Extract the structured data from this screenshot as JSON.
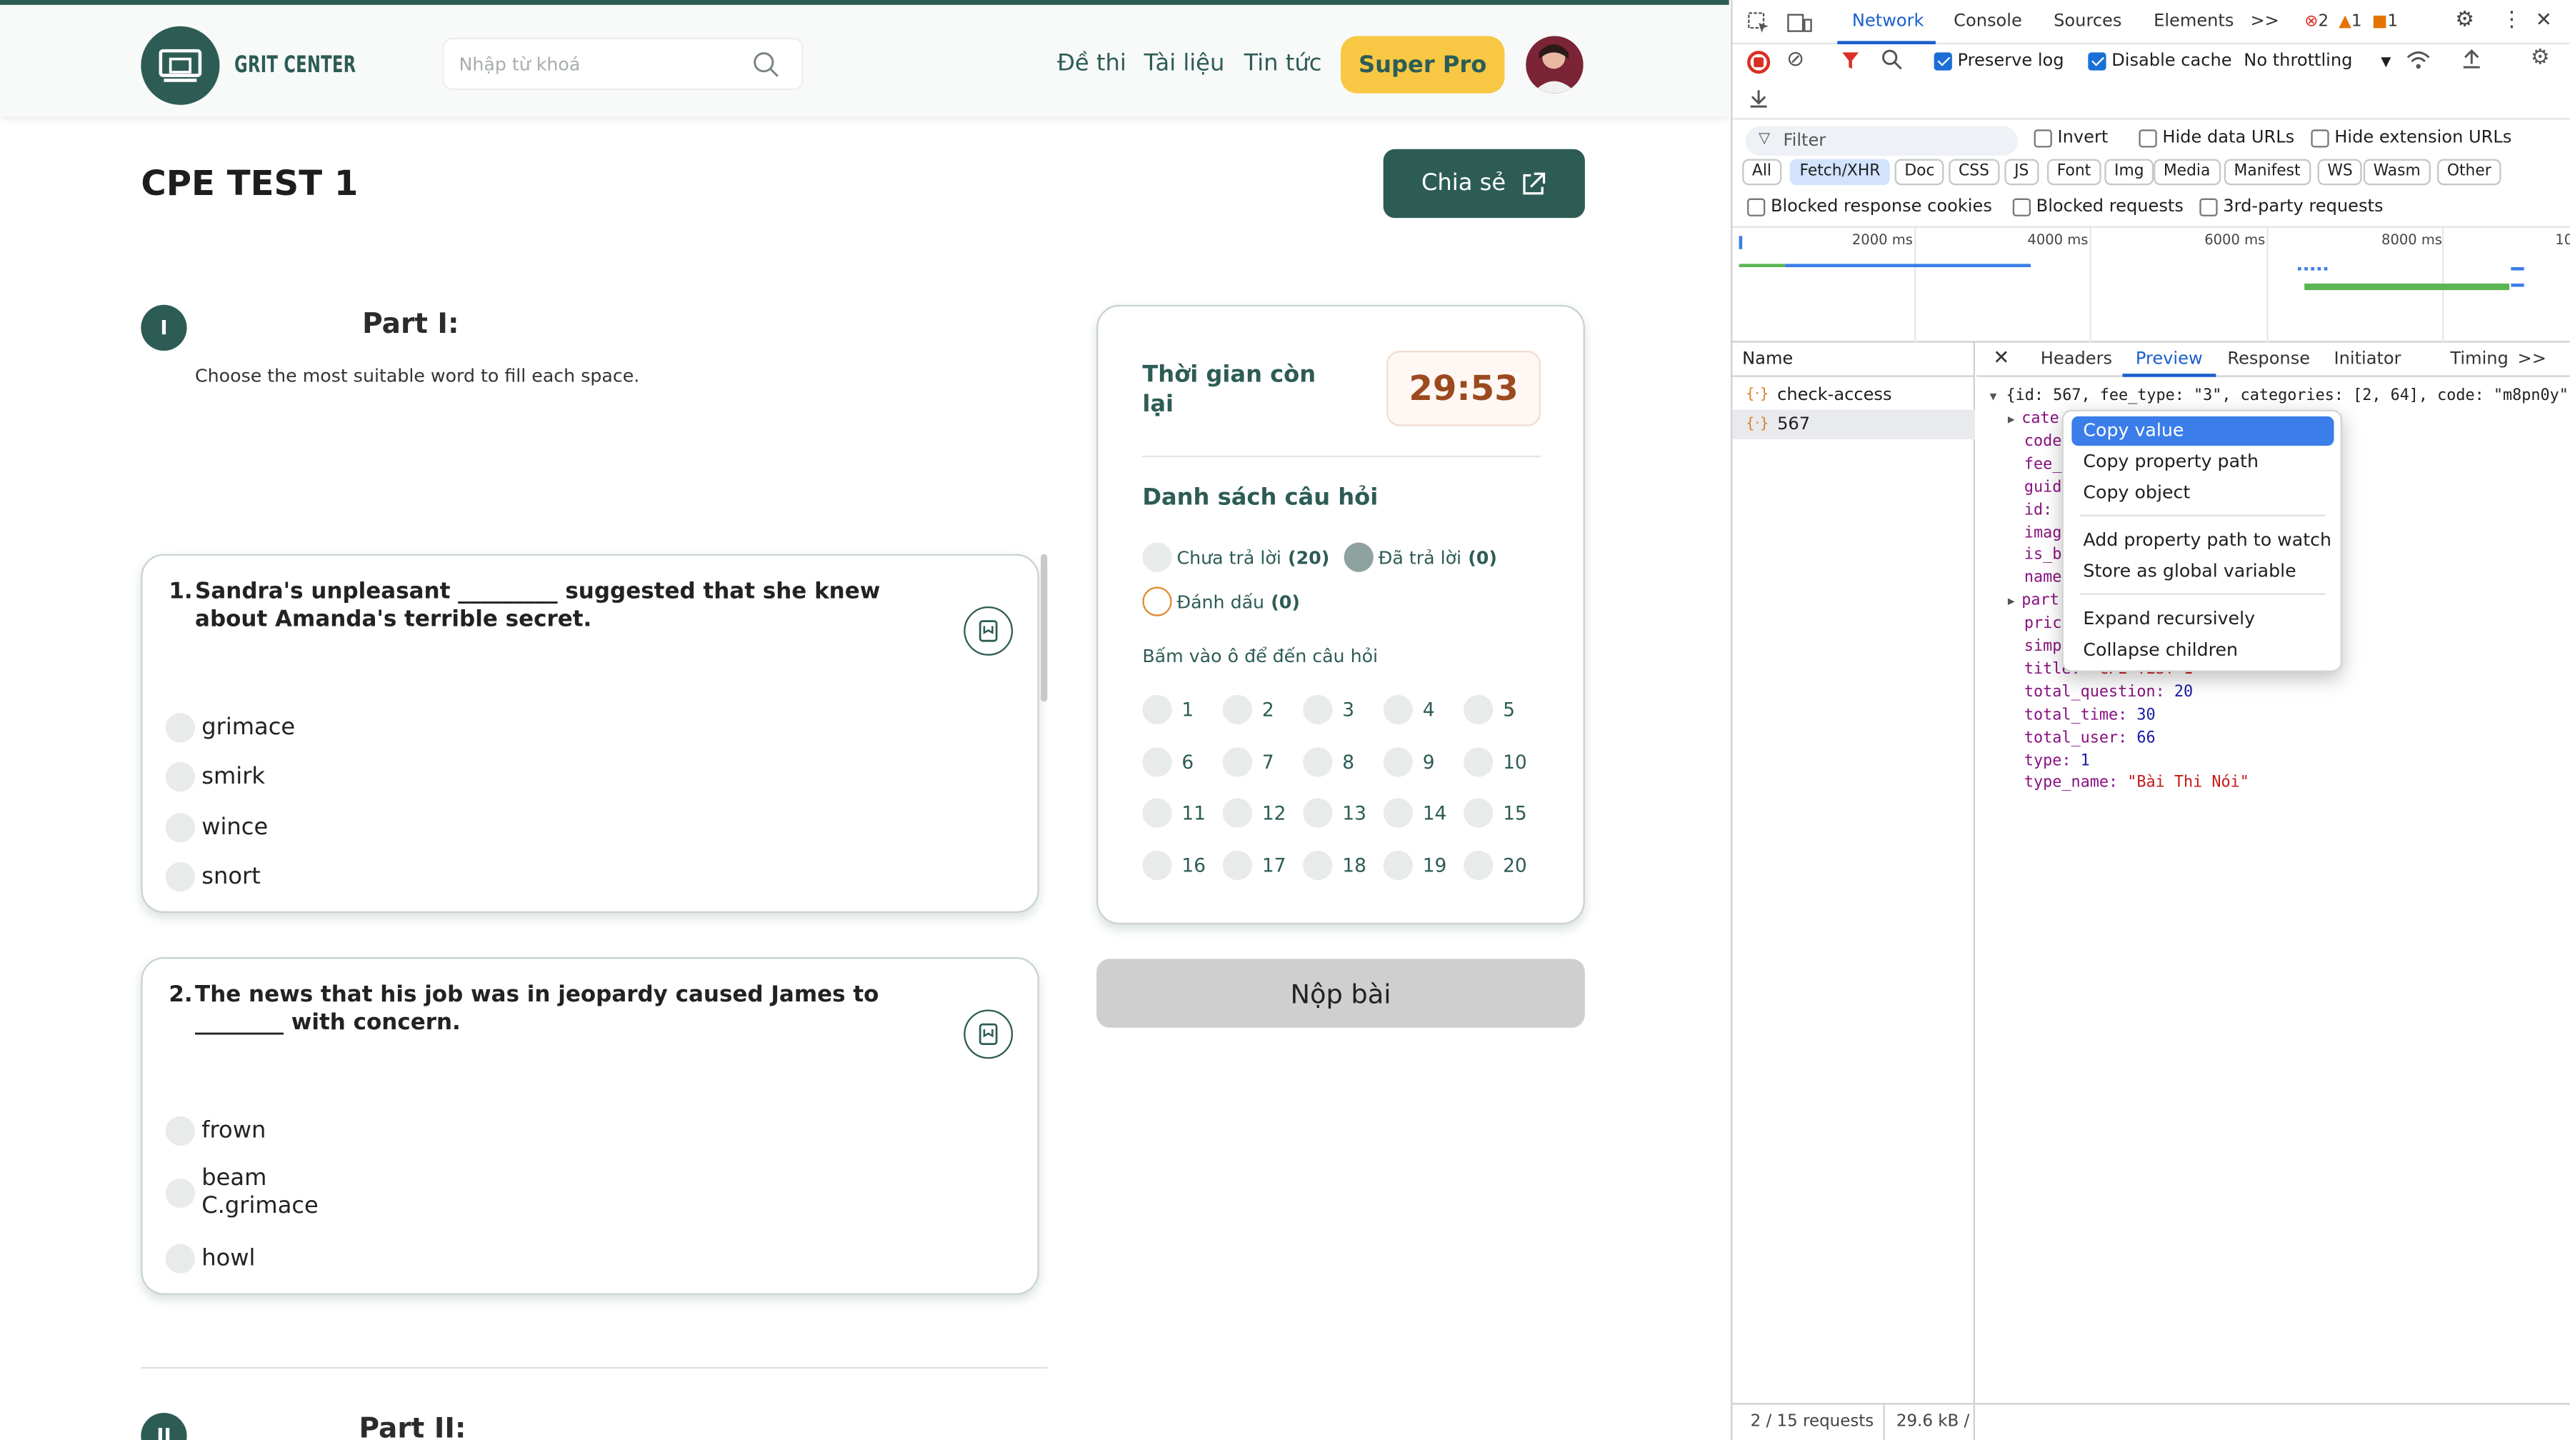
{
  "app": {
    "logo_text": "GRIT CENTER",
    "search_placeholder": "Nhập từ khoá",
    "nav": [
      "Đề thi",
      "Tài liệu",
      "Tin tức"
    ],
    "super_pro": "Super Pro",
    "page_title": "CPE TEST 1",
    "share_label": "Chia sẻ",
    "part1": {
      "badge": "I",
      "title": "Part I:",
      "desc": "Choose the most suitable word to fill each space."
    },
    "part2": {
      "badge": "II",
      "title": "Part II:"
    },
    "questions": [
      {
        "num": "1.",
        "text": "Sandra's unpleasant _________ suggested that she knew about Amanda's terrible secret.",
        "options": [
          "grimace",
          "smirk",
          "wince",
          "snort"
        ]
      },
      {
        "num": "2.",
        "text": "The news that his job was in jeopardy caused James to ________ with concern.",
        "options": [
          "frown",
          "beam\nC.grimace",
          "howl"
        ]
      }
    ],
    "panel": {
      "time_label": "Thời gian còn lại",
      "timer": "29:53",
      "list_title": "Danh sách câu hỏi",
      "unanswered_label": "Chưa trả lời",
      "unanswered_count": "(20)",
      "answered_label": "Đã trả lời",
      "answered_count": "(0)",
      "flagged_label": "Đánh dấu",
      "flagged_count": "(0)",
      "hint": "Bấm vào ô để đến câu hỏi",
      "numbers": [
        "1",
        "2",
        "3",
        "4",
        "5",
        "6",
        "7",
        "8",
        "9",
        "10",
        "11",
        "12",
        "13",
        "14",
        "15",
        "16",
        "17",
        "18",
        "19",
        "20"
      ]
    },
    "submit_label": "Nộp bài",
    "colors": {
      "primary": "#2d5c55",
      "accent": "#f8c844",
      "timer": "#9b4a1f"
    }
  },
  "devtools": {
    "tabs": [
      "Network",
      "Console",
      "Sources",
      "Elements"
    ],
    "more": ">>",
    "errors": "2",
    "warnings": "1",
    "issues": "1",
    "preserve_log": "Preserve log",
    "disable_cache": "Disable cache",
    "throttling": "No throttling",
    "filter_placeholder": "Filter",
    "invert": "Invert",
    "hide_data_urls": "Hide data URLs",
    "hide_ext_urls": "Hide extension URLs",
    "type_filters": [
      "All",
      "Fetch/XHR",
      "Doc",
      "CSS",
      "JS",
      "Font",
      "Img",
      "Media",
      "Manifest",
      "WS",
      "Wasm",
      "Other"
    ],
    "blocked_cookies": "Blocked response cookies",
    "blocked_requests": "Blocked requests",
    "third_party": "3rd-party requests",
    "ticks": [
      "2000 ms",
      "4000 ms",
      "6000 ms",
      "8000 ms",
      "10"
    ],
    "name_header": "Name",
    "requests": [
      "check-access",
      "567"
    ],
    "detail_tabs": [
      "Headers",
      "Preview",
      "Response",
      "Initiator",
      "Timing"
    ],
    "json_head": "{id: 567, fee_type: \"3\", categories: [2, 64], code: \"m8pn0y\"",
    "json_lines": [
      {
        "k": "cate",
        "v": "",
        "arrow": true
      },
      {
        "k": "code",
        "v": ""
      },
      {
        "k": "fee_",
        "v": ""
      },
      {
        "k": "guid",
        "v": ""
      },
      {
        "k": "id: ",
        "v": ""
      },
      {
        "k": "imag",
        "v": ""
      },
      {
        "k": "is_b",
        "v": ""
      },
      {
        "k": "name",
        "v": ""
      },
      {
        "k": "part",
        "v": "",
        "arrow": true
      },
      {
        "k": "pric",
        "v": ""
      },
      {
        "k": "simp",
        "v": ""
      },
      {
        "k": "title: ",
        "v": "\"CPE TEST 1\""
      },
      {
        "k": "total_question: ",
        "v": "20"
      },
      {
        "k": "total_time: ",
        "v": "30"
      },
      {
        "k": "total_user: ",
        "v": "66"
      },
      {
        "k": "type: ",
        "v": "1"
      },
      {
        "k": "type_name: ",
        "v": "\"Bài Thi Nói\""
      }
    ],
    "context_menu": [
      "Copy value",
      "Copy property path",
      "Copy object",
      "Add property path to watch",
      "Store as global variable",
      "Expand recursively",
      "Collapse children"
    ],
    "status_requests": "2 / 15 requests",
    "status_size": "29.6 kB /"
  }
}
